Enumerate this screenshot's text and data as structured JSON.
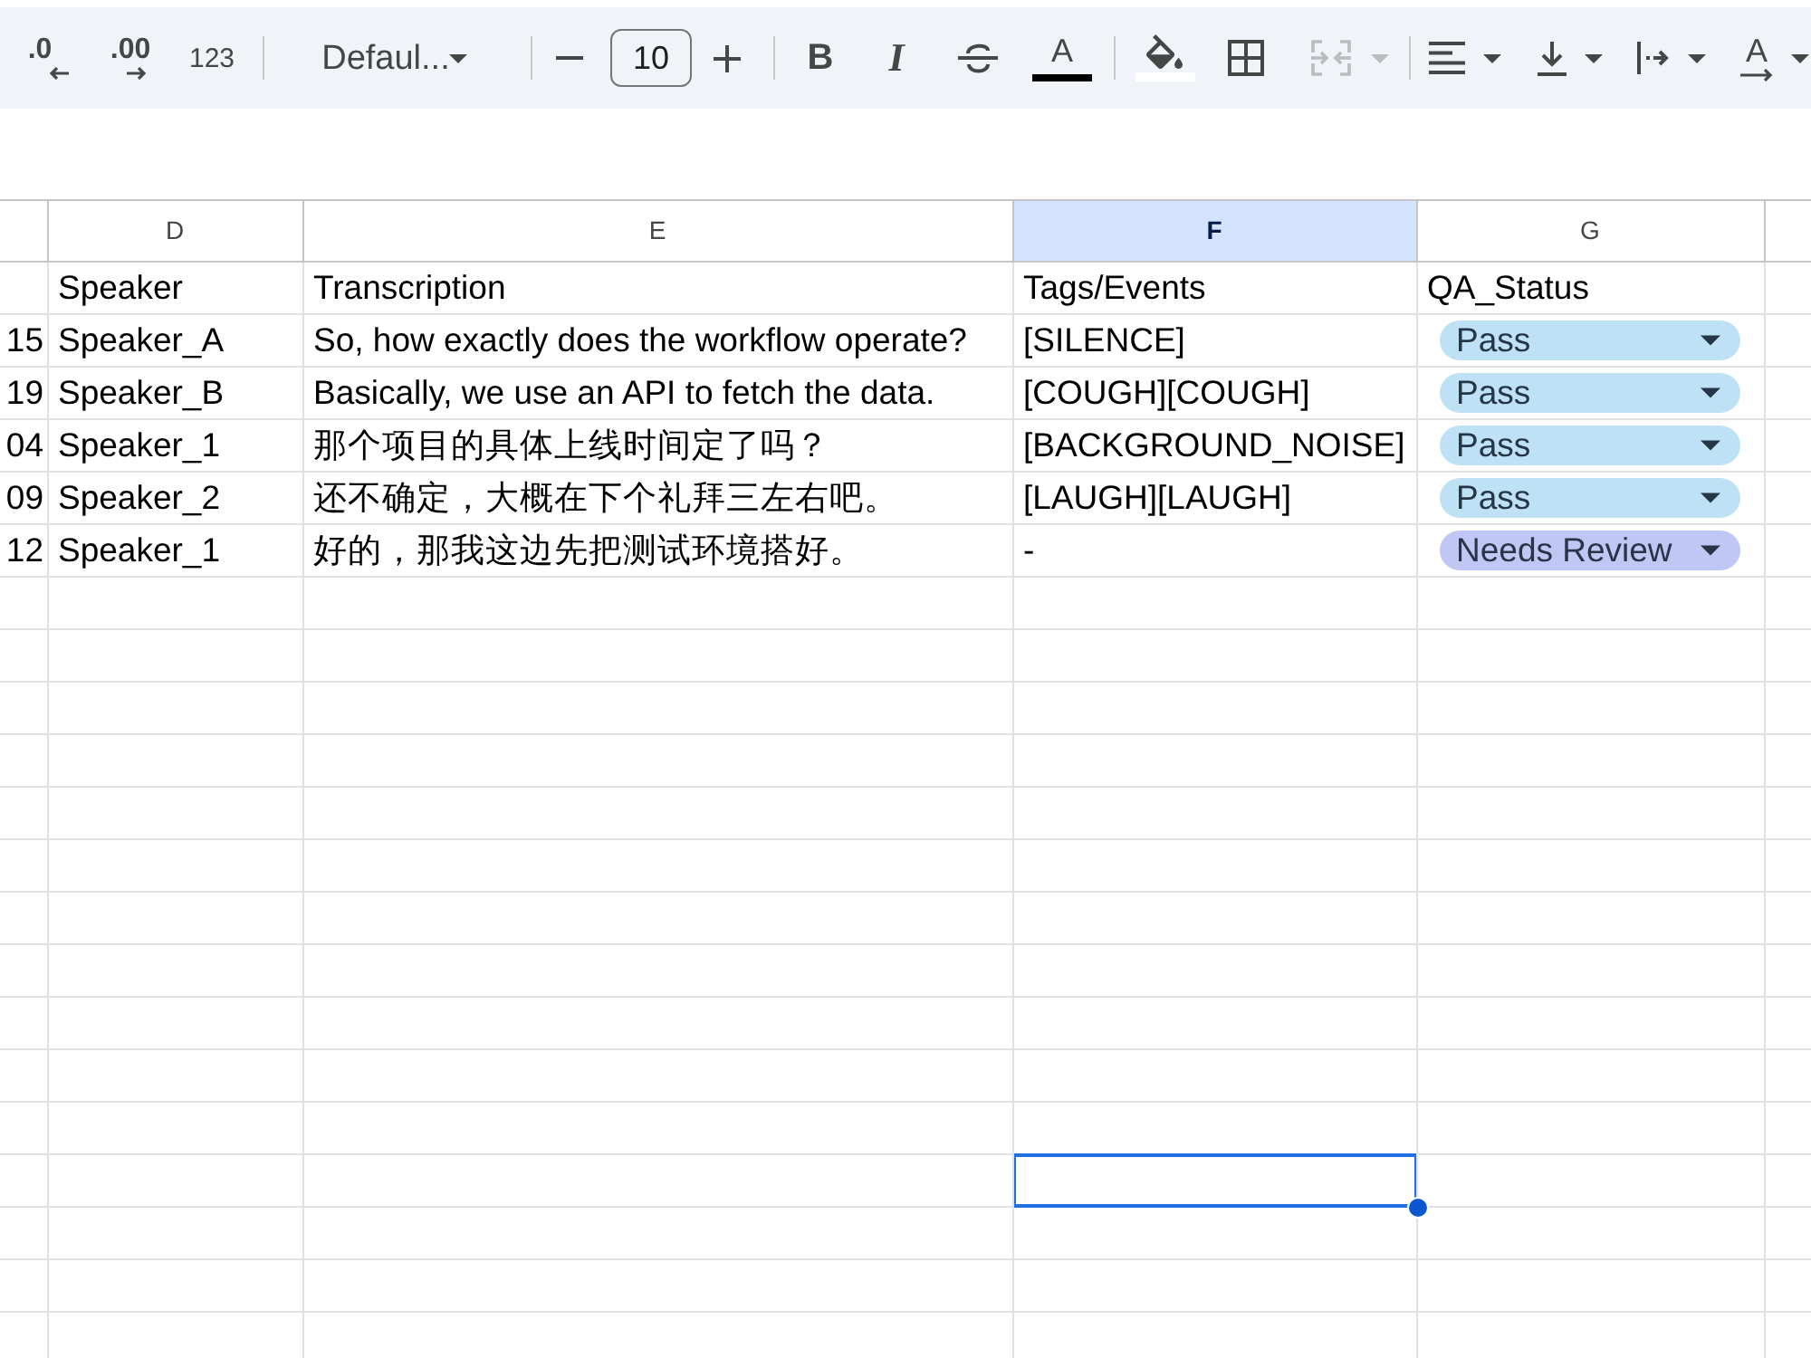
{
  "toolbar": [
    {
      "kind": "decrease_decimal",
      "label": ".0",
      "disabled": false
    },
    {
      "kind": "increase_decimal",
      "label": ".00",
      "disabled": false
    },
    {
      "kind": "number_format",
      "label": "123",
      "disabled": false
    },
    {
      "kind": "separator"
    },
    {
      "kind": "font",
      "label": "Defaul...",
      "disabled": false
    },
    {
      "kind": "separator"
    },
    {
      "kind": "size_down",
      "disabled": false
    },
    {
      "kind": "size_field",
      "value": "10",
      "disabled": false
    },
    {
      "kind": "size_up",
      "disabled": false
    },
    {
      "kind": "separator"
    },
    {
      "kind": "bold",
      "label": "B",
      "disabled": false
    },
    {
      "kind": "italic",
      "label": "I",
      "disabled": false
    },
    {
      "kind": "strikethrough",
      "disabled": false
    },
    {
      "kind": "text_color",
      "label": "A",
      "disabled": false
    },
    {
      "kind": "separator"
    },
    {
      "kind": "fill_color",
      "disabled": false
    },
    {
      "kind": "borders",
      "disabled": false
    },
    {
      "kind": "merge",
      "disabled": true
    },
    {
      "kind": "separator"
    },
    {
      "kind": "align",
      "disabled": false
    },
    {
      "kind": "valign",
      "disabled": false
    },
    {
      "kind": "wrap",
      "disabled": false
    },
    {
      "kind": "rotate",
      "label": "A",
      "disabled": false
    }
  ],
  "columns": [
    {
      "selected": false
    },
    {
      "letter": "D",
      "selected": false
    },
    {
      "letter": "E",
      "selected": false
    },
    {
      "letter": "F",
      "selected": true
    },
    {
      "letter": "G",
      "selected": false
    },
    {
      "selected": false
    }
  ],
  "rows": [
    {
      "speaker": "Speaker",
      "transcription": "Transcription",
      "tags_events": "Tags/Events",
      "qa_status": "QA_Status",
      "selected": false
    },
    {
      "column_c": "15",
      "speaker": "Speaker_A",
      "transcription": "So, how exactly does the workflow operate?",
      "tags_events": "[SILENCE]",
      "qa_status": {
        "label": "Pass",
        "color": "#bfe1f6"
      },
      "selected": false
    },
    {
      "column_c": "19",
      "speaker": "Speaker_B",
      "transcription": "Basically, we use an API to fetch the data.",
      "tags_events": "[COUGH][COUGH]",
      "qa_status": {
        "label": "Pass",
        "color": "#bfe1f6"
      },
      "selected": false
    },
    {
      "column_c": "04",
      "speaker": "Speaker_1",
      "transcription": "那个项目的具体上线时间定了吗？",
      "tags_events": "[BACKGROUND_NOISE]",
      "qa_status": {
        "label": "Pass",
        "color": "#bfe1f6"
      },
      "selected": false
    },
    {
      "column_c": "09",
      "speaker": "Speaker_2",
      "transcription": "还不确定，大概在下个礼拜三左右吧。",
      "tags_events": "[LAUGH][LAUGH]",
      "qa_status": {
        "label": "Pass",
        "color": "#bfe1f6"
      },
      "selected": false
    },
    {
      "column_c": "12",
      "speaker": "Speaker_1",
      "transcription": "好的，那我这边先把测试环境搭好。",
      "tags_events": "-",
      "qa_status": {
        "label": "Needs Review",
        "color": "#c1c7f4"
      },
      "selected": false
    },
    {
      "selected": false
    },
    {
      "selected": false
    },
    {
      "selected": false
    },
    {
      "selected": false
    },
    {
      "selected": false
    },
    {
      "selected": false
    },
    {
      "selected": false
    },
    {
      "selected": false
    },
    {
      "selected": false
    },
    {
      "selected": false
    },
    {
      "selected": false
    },
    {
      "selected": true
    },
    {
      "selected": false
    },
    {
      "selected": false
    },
    {
      "selected": false
    }
  ]
}
